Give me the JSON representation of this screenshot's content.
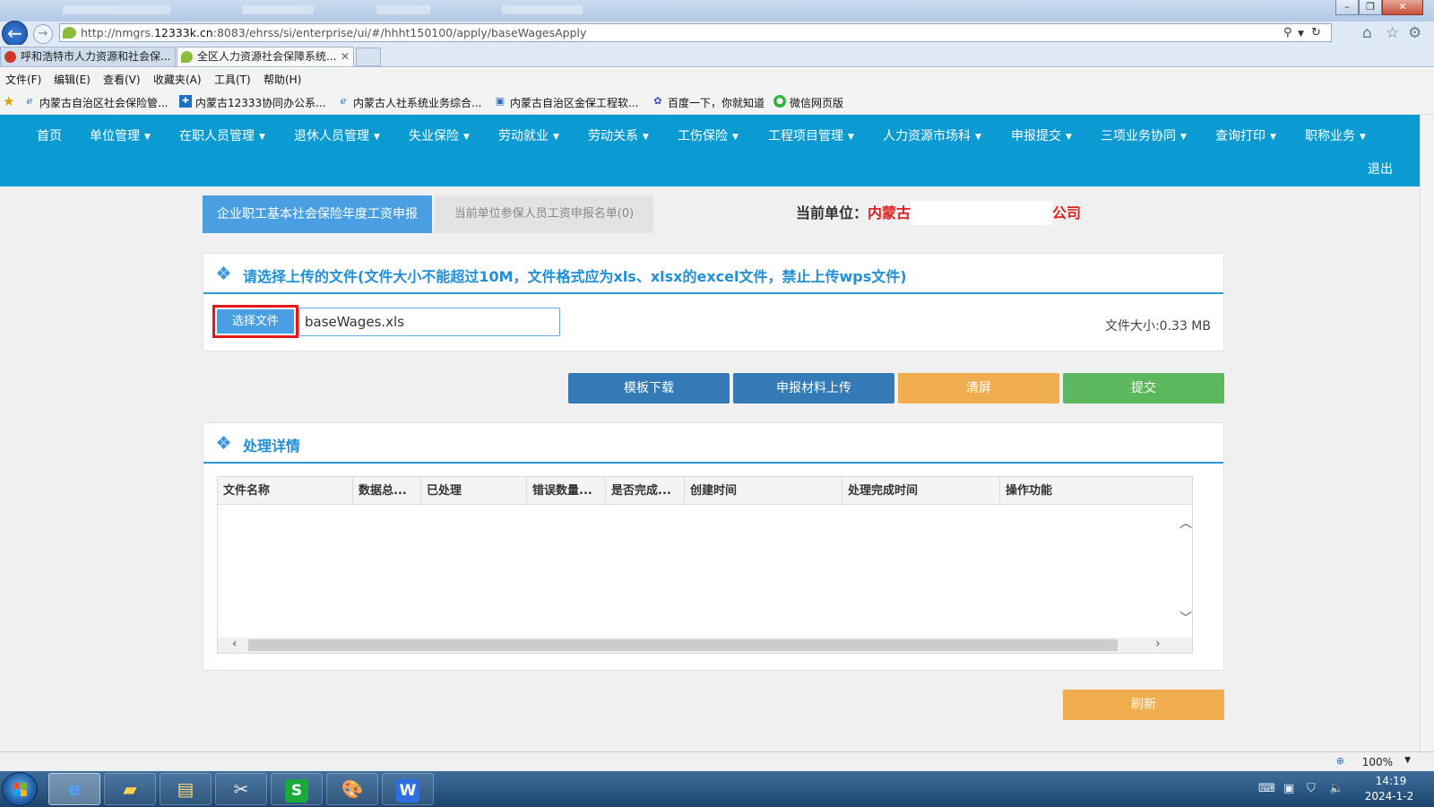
{
  "browser": {
    "url_prefix": "http://nmgrs.",
    "url_domain": "12333k.cn",
    "url_rest": ":8083/ehrss/si/enterprise/ui/#/hhht150100/apply/baseWagesApply",
    "tabs": [
      {
        "label": "呼和浩特市人力资源和社会保..."
      },
      {
        "label": "全区人力资源社会保障系统..."
      }
    ],
    "tab_close": "✕",
    "menu": [
      "文件(F)",
      "编辑(E)",
      "查看(V)",
      "收藏夹(A)",
      "工具(T)",
      "帮助(H)"
    ],
    "favorites": [
      {
        "label": "内蒙古自治区社会保险管...",
        "icon": "ie-page-icon"
      },
      {
        "label": "内蒙古12333协同办公系...",
        "icon": "app-icon"
      },
      {
        "label": "内蒙古人社系统业务综合...",
        "icon": "ie-page-icon"
      },
      {
        "label": "内蒙古自治区金保工程软...",
        "icon": "doc-icon"
      },
      {
        "label": "百度一下，你就知道",
        "icon": "baidu-paw-icon"
      },
      {
        "label": "微信网页版",
        "icon": "wechat-icon"
      }
    ],
    "zoom": "100%"
  },
  "nav": {
    "items": [
      "首页",
      "单位管理",
      "在职人员管理",
      "退休人员管理",
      "失业保险",
      "劳动就业",
      "劳动关系",
      "工伤保险",
      "工程项目管理",
      "人力资源市场科",
      "申报提交",
      "三项业务协同",
      "查询打印",
      "职称业务"
    ],
    "logout": "退出"
  },
  "tabs": {
    "active": "企业职工基本社会保险年度工资申报",
    "inactive": "当前单位参保人员工资申报名单(0)"
  },
  "unit": {
    "label": "当前单位：",
    "name_start": "内蒙古",
    "name_end": "公司"
  },
  "upload": {
    "title": "请选择上传的文件(文件大小不能超过10M，文件格式应为xls、xlsx的excel文件，禁止上传wps文件)",
    "choose_button": "选择文件",
    "file_name": "baseWages.xls",
    "file_size": "文件大小:0.33 MB"
  },
  "actions": {
    "template_download": "模板下载",
    "material_upload": "申报材料上传",
    "clear": "清屏",
    "submit": "提交"
  },
  "details": {
    "title": "处理详情",
    "columns": [
      "文件名称",
      "数据总...",
      "已处理",
      "错误数量...",
      "是否完成...",
      "创建时间",
      "处理完成时间",
      "操作功能"
    ],
    "rows": []
  },
  "refresh": "刷新",
  "taskbar": {
    "time": "14:19",
    "date": "2024-1-2"
  },
  "colors": {
    "nav_bg": "#0b9bd3",
    "tab_active": "#4a9fe3",
    "btn_blue": "#337ab7",
    "btn_orange": "#f0ad4e",
    "btn_green": "#5cb85c",
    "highlight_red": "#e01919"
  }
}
